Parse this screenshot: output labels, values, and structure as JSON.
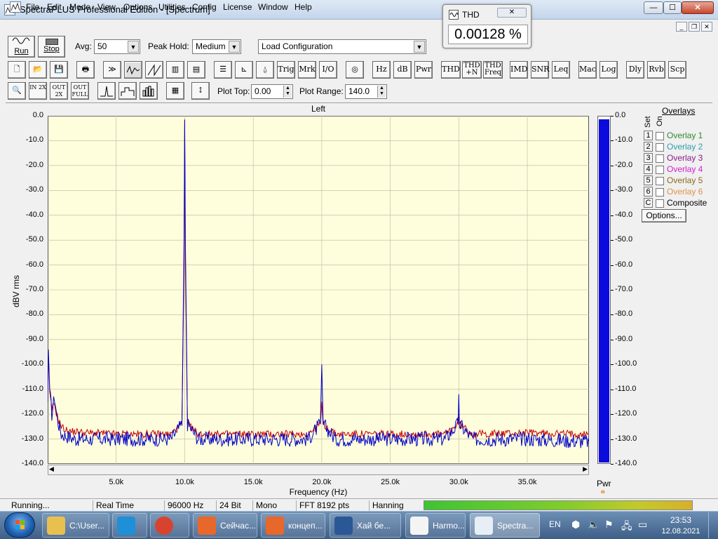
{
  "window": {
    "title": "SpectraPLUS Professional Edition - [Spectrum]",
    "min_glyph": "—",
    "max_glyph": "☐",
    "close_glyph": "✕"
  },
  "menu": [
    "File",
    "Edit",
    "Mode",
    "View",
    "Options",
    "Utilities",
    "Config",
    "License",
    "Window",
    "Help"
  ],
  "mdi_buttons": [
    "_",
    "❐",
    "✕"
  ],
  "toolbar1": {
    "run_label": "Run",
    "stop_label": "Stop",
    "avg_label": "Avg:",
    "avg_value": "50",
    "peak_hold_label": "Peak Hold:",
    "peak_hold_value": "Medium",
    "config_value": "Load Configuration"
  },
  "toolbar2": {
    "text_buttons": [
      "Trig",
      "Mrk",
      "I/O",
      "Hz",
      "dB",
      "Pwr",
      "THD",
      "THD +N",
      "THD Freq",
      "IMD",
      "SNR",
      "Leq",
      "Mac",
      "Log",
      "Dly",
      "Rvb",
      "Scp"
    ]
  },
  "toolbar3": {
    "zoom_in": "IN 2X",
    "zoom_out": "OUT 2X",
    "zoom_full": "OUT FULL",
    "plot_top_label": "Plot Top:",
    "plot_top_value": "0.00",
    "plot_range_label": "Plot Range:",
    "plot_range_value": "140.0"
  },
  "thd_popup": {
    "title": "THD",
    "close": "✕",
    "value": "0.00128 %"
  },
  "plot": {
    "channel": "Left",
    "ylabel": "dBV rms",
    "xlabel": "Frequency (Hz)",
    "pwr_label": "Pwr"
  },
  "chart_data": {
    "type": "line",
    "title": "Left",
    "xlabel": "Frequency (Hz)",
    "ylabel": "dBV rms",
    "xlim": [
      0,
      39500
    ],
    "ylim": [
      -140,
      0
    ],
    "y_ticks": [
      "0.0",
      "-10.0",
      "-20.0",
      "-30.0",
      "-40.0",
      "-50.0",
      "-60.0",
      "-70.0",
      "-80.0",
      "-90.0",
      "-100.0",
      "-110.0",
      "-120.0",
      "-130.0",
      "-140.0"
    ],
    "x_ticks": [
      "5.0k",
      "10.0k",
      "15.0k",
      "20.0k",
      "25.0k",
      "30.0k",
      "35.0k"
    ],
    "x_tick_values": [
      5000,
      10000,
      15000,
      20000,
      25000,
      30000,
      35000
    ],
    "grid": true,
    "series": [
      {
        "color": "#0000c8",
        "x": [
          0,
          50,
          150,
          300,
          500,
          700,
          1000,
          1500,
          2000,
          3000,
          5000,
          7000,
          9000,
          9800,
          9950,
          10000,
          10050,
          10200,
          11000,
          13000,
          15000,
          17000,
          19000,
          19900,
          20000,
          20100,
          21000,
          25000,
          29000,
          29950,
          30000,
          30050,
          31000,
          35000,
          39500
        ],
        "y": [
          -115,
          -94,
          -110,
          -120,
          -113,
          -122,
          -128,
          -129,
          -130,
          -130,
          -130,
          -130,
          -130,
          -124,
          -50,
          -1.5,
          -50,
          -124,
          -130,
          -130,
          -130,
          -130,
          -130,
          -124,
          -100,
          -124,
          -130,
          -130,
          -130,
          -124,
          -112,
          -124,
          -130,
          -130,
          -131
        ]
      },
      {
        "color": "#c80000",
        "x": [
          0,
          50,
          150,
          300,
          500,
          700,
          1000,
          1500,
          2000,
          3000,
          5000,
          7000,
          9000,
          9800,
          9950,
          10000,
          10050,
          10200,
          11000,
          13000,
          15000,
          17000,
          19000,
          19900,
          20000,
          20100,
          21000,
          25000,
          29000,
          29950,
          30000,
          30050,
          31000,
          35000,
          39500
        ],
        "y": [
          -113,
          -96,
          -112,
          -118,
          -116,
          -121,
          -125,
          -127,
          -127,
          -127.5,
          -128,
          -128,
          -128,
          -124,
          -60,
          -2,
          -60,
          -124,
          -128,
          -128,
          -128,
          -128,
          -128,
          -124,
          -115,
          -124,
          -128,
          -128,
          -128,
          -124,
          -120,
          -124,
          -128,
          -127.5,
          -128
        ]
      }
    ]
  },
  "pwr_scale": [
    "0.0",
    "-10.0",
    "-20.0",
    "-30.0",
    "-40.0",
    "-50.0",
    "-60.0",
    "-70.0",
    "-80.0",
    "-90.0",
    "-100.0",
    "-110.0",
    "-120.0",
    "-130.0",
    "-140.0"
  ],
  "overlays": {
    "header": "Overlays",
    "col_set": "Set",
    "col_on": "On",
    "items": [
      {
        "num": "1",
        "label": "Overlay 1",
        "color": "#2e8b2e"
      },
      {
        "num": "2",
        "label": "Overlay 2",
        "color": "#2aa0a8"
      },
      {
        "num": "3",
        "label": "Overlay 3",
        "color": "#8b1a8b"
      },
      {
        "num": "4",
        "label": "Overlay 4",
        "color": "#d020d0"
      },
      {
        "num": "5",
        "label": "Overlay 5",
        "color": "#8b6a1a"
      },
      {
        "num": "6",
        "label": "Overlay 6",
        "color": "#e0904a"
      },
      {
        "num": "C",
        "label": "Composite",
        "color": "#000000"
      }
    ],
    "options_label": "Options..."
  },
  "statusbar": {
    "state": "Running...",
    "mode": "Real Time",
    "rate": "96000 Hz",
    "bits": "24 Bit",
    "channels": "Mono",
    "fft": "FFT 8192 pts",
    "window": "Hanning"
  },
  "taskbar": {
    "items": [
      {
        "label": "C:\\User...",
        "color": "#e8c050"
      },
      {
        "label": "",
        "color": "#1f8fd8"
      },
      {
        "label": "",
        "color": "#d8432f"
      },
      {
        "label": "Сейчас...",
        "color": "#e8672a"
      },
      {
        "label": "концеп...",
        "color": "#e8672a"
      },
      {
        "label": "Хай бе...",
        "color": "#2b5797"
      },
      {
        "label": "Harmo...",
        "color": "#f4f4f4"
      },
      {
        "label": "Spectra...",
        "color": "#e8eef6"
      }
    ],
    "lang": "EN",
    "time": "23:53",
    "date": "12.08.2021"
  }
}
